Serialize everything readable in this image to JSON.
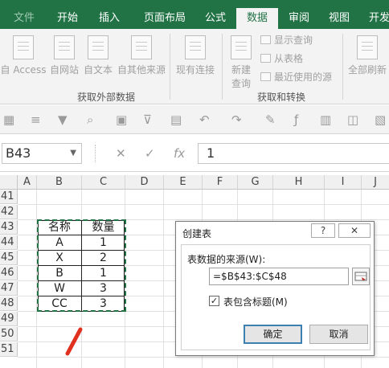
{
  "tabs": [
    {
      "label": "文件"
    },
    {
      "label": "开始"
    },
    {
      "label": "插入"
    },
    {
      "label": "页面布局"
    },
    {
      "label": "公式"
    },
    {
      "label": "数据"
    },
    {
      "label": "审阅"
    },
    {
      "label": "视图"
    },
    {
      "label": "开发"
    }
  ],
  "active_tab": "数据",
  "ribbon": {
    "get_external": {
      "access": "自 Access",
      "web": "自网站",
      "text": "自文本",
      "other": "自其他来源",
      "existing": "现有连接",
      "label": "获取外部数据"
    },
    "get_transform": {
      "new_query_1": "新建",
      "new_query_2": "查询",
      "show_queries": "显示查询",
      "from_table": "从表格",
      "recent_sources": "最近使用的源",
      "label": "获取和转换"
    },
    "refresh_all": "全部刷新"
  },
  "formula_bar": {
    "name_box": "B43",
    "cancel": "✕",
    "enter": "✓",
    "fx": "fx",
    "value": "1"
  },
  "columns": [
    "A",
    "B",
    "C",
    "D",
    "E",
    "F",
    "G",
    "H",
    "I",
    "J"
  ],
  "rows": [
    "41",
    "42",
    "43",
    "44",
    "45",
    "46",
    "47",
    "48",
    "49",
    "50",
    "51"
  ],
  "table": {
    "headers": [
      "名称",
      "数量"
    ],
    "rows": [
      [
        "A",
        "1"
      ],
      [
        "X",
        "2"
      ],
      [
        "B",
        "1"
      ],
      [
        "W",
        "3"
      ],
      [
        "CC",
        "3"
      ]
    ]
  },
  "dialog": {
    "title": "创建表",
    "help": "?",
    "close": "✕",
    "source_label": "表数据的来源(W):",
    "source_value": "=$B$43:$C$48",
    "has_headers_label": "表包含标题(M)",
    "has_headers_checked": "✓",
    "ok": "确定",
    "cancel": "取消"
  },
  "colors": {
    "accent": "#217346",
    "annotation": "#e0301e"
  }
}
